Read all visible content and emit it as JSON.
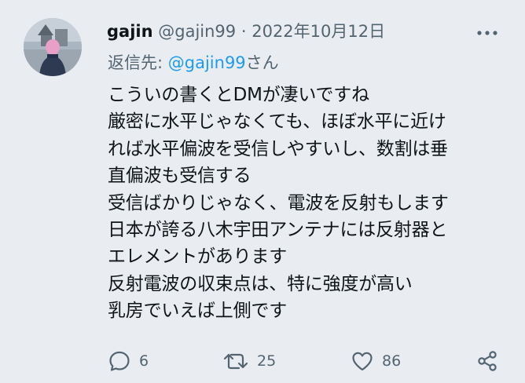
{
  "tweet": {
    "display_name": "gajin",
    "handle": "@gajin99",
    "separator": "·",
    "date": "2022年10月12日",
    "reply_prefix": "返信先: ",
    "reply_handle": "@gajin99",
    "reply_suffix": "さん",
    "body_lines": [
      "こういの書くとDMが凄いですね",
      "厳密に水平じゃなくても、ほぼ水平に近け",
      "れば水平偏波を受信しやすいし、数割は垂",
      "直偏波も受信する",
      "受信ばかりじゃなく、電波を反射もします",
      "日本が誇る八木宇田アンテナには反射器と",
      "エレメントがあります",
      "反射電波の収束点は、特に強度が高い",
      "乳房でいえば上側です"
    ]
  },
  "actions": {
    "reply_count": "6",
    "retweet_count": "25",
    "like_count": "86"
  },
  "icons": {
    "reply": "reply-icon",
    "retweet": "retweet-icon",
    "like": "heart-icon",
    "share": "share-icon",
    "more": "more-icon"
  },
  "colors": {
    "background": "#e9edf1",
    "text": "#0f1419",
    "secondary": "#536471",
    "link": "#1d9bf0"
  }
}
